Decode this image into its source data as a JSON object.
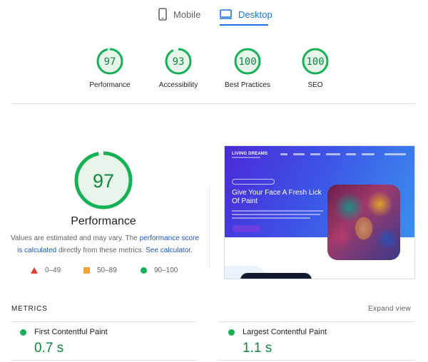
{
  "tabs": {
    "mobile": "Mobile",
    "desktop": "Desktop",
    "active": "desktop"
  },
  "colors": {
    "accent": "#1a73e8",
    "pass": "#0c8a3b",
    "pass_ring": "#14b155",
    "average": "#f4a12d",
    "fail": "#e53935"
  },
  "summary": [
    {
      "score": "97",
      "value": 97,
      "label": "Performance"
    },
    {
      "score": "93",
      "value": 93,
      "label": "Accessibility"
    },
    {
      "score": "100",
      "value": 100,
      "label": "Best Practices"
    },
    {
      "score": "100",
      "value": 100,
      "label": "SEO"
    }
  ],
  "performance": {
    "score": "97",
    "value": 97,
    "title": "Performance",
    "note_prefix": "Values are estimated and may vary. The ",
    "note_link1": "performance score is calculated",
    "note_middle": " directly from these metrics. ",
    "note_link2": "See calculator."
  },
  "legend": [
    {
      "icon": "triangle-icon",
      "range": "0–49"
    },
    {
      "icon": "square-icon",
      "range": "50–89"
    },
    {
      "icon": "circle-icon",
      "range": "90–100"
    }
  ],
  "screenshot": {
    "logo": "LIVING DREAMS",
    "headline": "Give Your Face A Fresh Lick Of Paint"
  },
  "metrics": {
    "heading": "METRICS",
    "expand": "Expand view",
    "items": [
      {
        "name": "First Contentful Paint",
        "value": "0.7 s"
      },
      {
        "name": "Largest Contentful Paint",
        "value": "1.1 s"
      }
    ]
  }
}
